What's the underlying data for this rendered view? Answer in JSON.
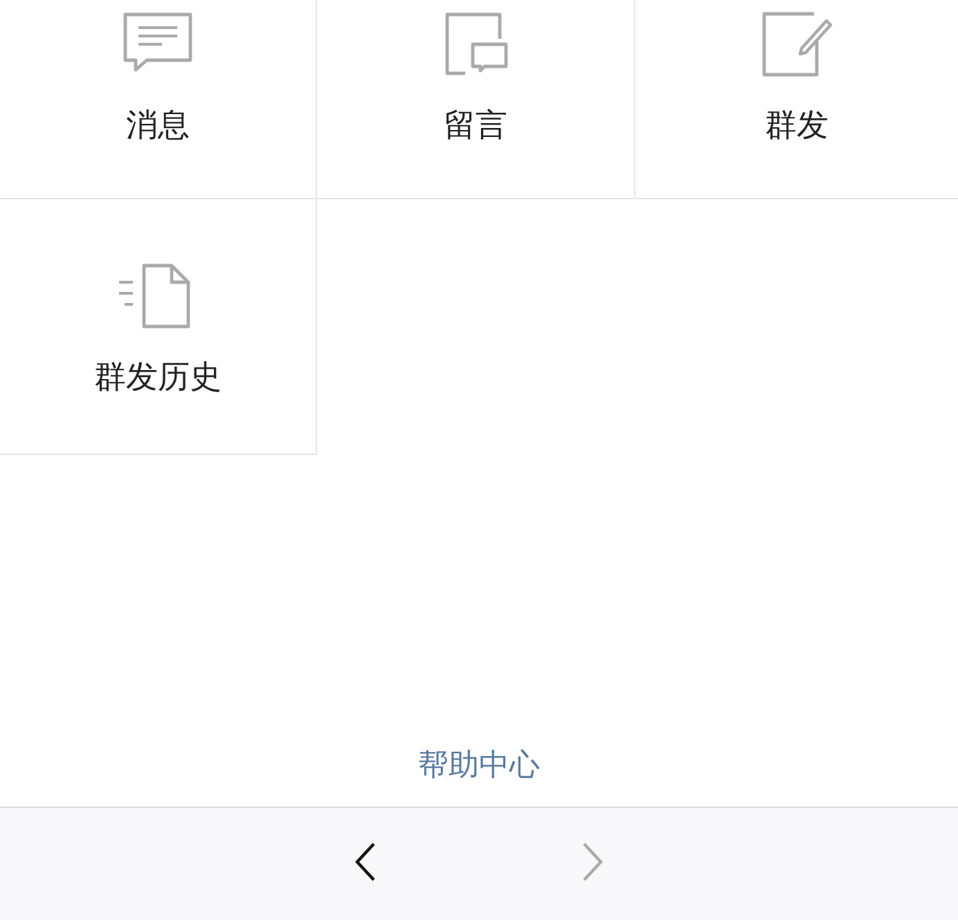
{
  "grid": {
    "items": [
      {
        "label": "消息",
        "kind": "message"
      },
      {
        "label": "留言",
        "kind": "board"
      },
      {
        "label": "群发",
        "kind": "compose"
      },
      {
        "label": "群发历史",
        "kind": "history"
      }
    ]
  },
  "help_link": "帮助中心",
  "nav": [
    {
      "kind": "back",
      "disabled": false
    },
    {
      "kind": "forward",
      "disabled": true
    }
  ]
}
